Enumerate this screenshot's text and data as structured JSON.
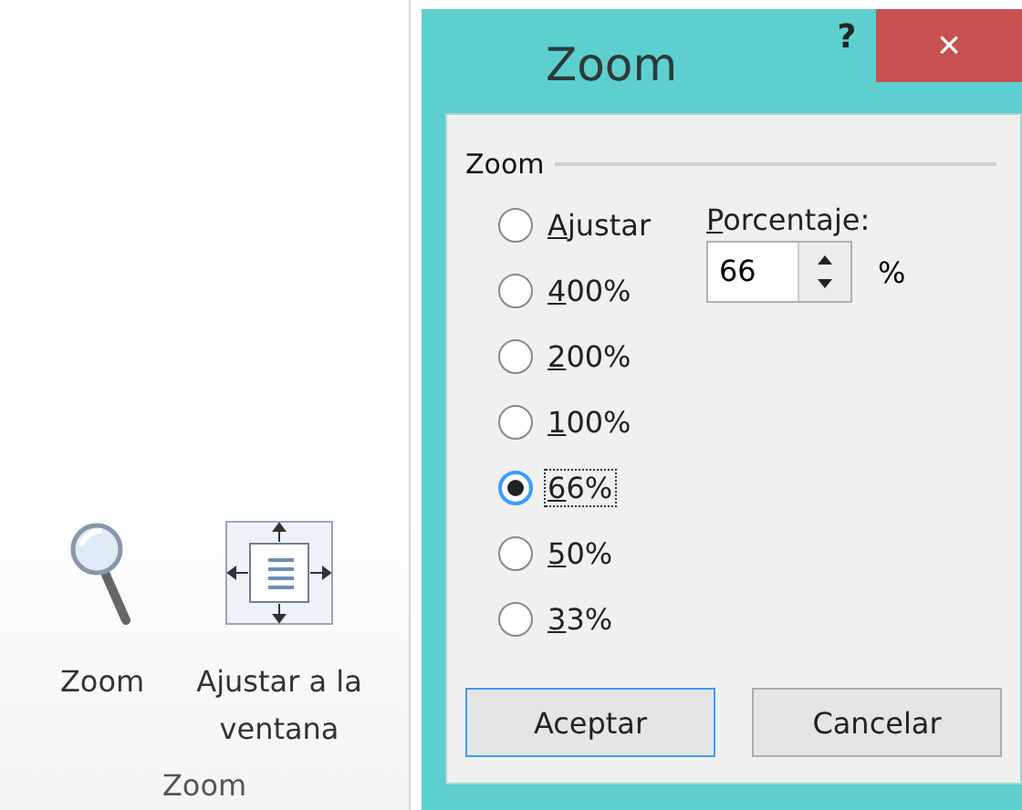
{
  "ribbon": {
    "buttons": [
      {
        "kind": "zoom",
        "label": "Zoom"
      },
      {
        "kind": "fit",
        "label": "Ajustar a la ventana"
      }
    ],
    "group_label": "Zoom"
  },
  "dialog": {
    "title": "Zoom",
    "help": "?",
    "close": "×",
    "group_title": "Zoom",
    "options": [
      {
        "label": "Ajustar",
        "mnemonic": true,
        "selected": false
      },
      {
        "label": "400%",
        "mnemonic": true,
        "selected": false
      },
      {
        "label": "200%",
        "mnemonic": true,
        "selected": false
      },
      {
        "label": "100%",
        "mnemonic": true,
        "selected": false
      },
      {
        "label": "66%",
        "mnemonic": true,
        "selected": true
      },
      {
        "label": "50%",
        "mnemonic": true,
        "selected": false
      },
      {
        "label": "33%",
        "mnemonic": true,
        "selected": false
      }
    ],
    "percent": {
      "label": "Porcentaje:",
      "mnemonic": true,
      "value": "66",
      "unit": "%"
    },
    "buttons": [
      {
        "label": "Aceptar",
        "default": true
      },
      {
        "label": "Cancelar",
        "default": false
      }
    ]
  }
}
